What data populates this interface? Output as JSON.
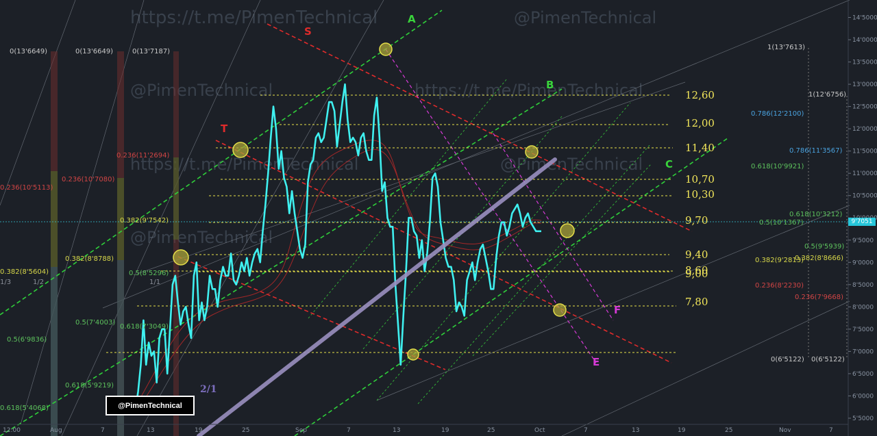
{
  "watermarks": {
    "w1": "https://t.me/PimenTechnical",
    "w2": "@PimenTechnical",
    "w3": "@PimenTechnical",
    "w4": "https://t.me/PimenTechnical",
    "w5": "https://t.me/PimenTechnical",
    "w6": "@PimenTechnical",
    "w7": "@PimenTechnical"
  },
  "brand_label": "@PimenTechnical",
  "current_price_tag": "9'7051",
  "colors": {
    "background": "#1c2027",
    "price_line": "#3ff0f0",
    "level_lines": "#e8e24a",
    "channel_green": "#39d33b",
    "resistance_red": "#e02b2b",
    "projection_magenta": "#d63ad6",
    "trendline": "#9a8fbf"
  },
  "chart_data": {
    "type": "line",
    "title": "",
    "xlabel": "",
    "ylabel": "",
    "ylim": [
      5100,
      14600
    ],
    "x_ticks": [
      "12:00",
      "Aug",
      "7",
      "13",
      "19",
      "25",
      "Sep",
      "7",
      "13",
      "19",
      "25",
      "Oct",
      "7",
      "13",
      "19",
      "25",
      "Nov",
      "7"
    ],
    "y_ticks": [
      "14'5000",
      "14'0000",
      "13'5000",
      "13'0000",
      "12'5000",
      "12'0000",
      "11'5000",
      "11'0000",
      "10'5000",
      "10'0000",
      "9'5000",
      "9'0000",
      "8'5000",
      "8'0000",
      "7'5000",
      "7'0000",
      "6'5000",
      "6'0000",
      "5'5000"
    ],
    "series": [
      {
        "values": [
          5600,
          5900,
          5700,
          6100,
          6700,
          7700,
          6700,
          7200,
          6900,
          7000,
          6300,
          7300,
          7500,
          7500,
          6500,
          7500,
          8500,
          8700,
          8100,
          7600,
          7900,
          8000,
          7600,
          7300,
          8700,
          9000,
          7700,
          8100,
          7700,
          8000,
          8700,
          8400,
          8400,
          8000,
          8600,
          8900,
          8700,
          8700,
          9200,
          8600,
          8500,
          8700,
          9000,
          8800,
          9100,
          8700,
          9000,
          9200,
          9300,
          9000,
          9700,
          10300,
          11000,
          11800,
          12500,
          12000,
          11100,
          11500,
          10900,
          10700,
          10100,
          10600,
          10100,
          9700,
          9300,
          9100,
          9400,
          10800,
          11200,
          11300,
          11800,
          11900,
          11700,
          11800,
          12200,
          12600,
          12600,
          12400,
          11600,
          12100,
          12600,
          13000,
          12200,
          11700,
          11800,
          11700,
          11400,
          11800,
          11900,
          11500,
          11300,
          11300,
          12300,
          12700,
          11800,
          10600,
          10800,
          10000,
          9800,
          9800,
          8500,
          7600,
          6700,
          7800,
          8800,
          10000,
          10000,
          9700,
          9600,
          9100,
          9500,
          8800,
          9200,
          9900,
          10900,
          11000,
          10700,
          9900,
          9500,
          9100,
          8900,
          8900,
          8600,
          7900,
          8100,
          8000,
          7800,
          8600,
          8800,
          9000,
          8600,
          9000,
          9300,
          9400,
          9100,
          8800,
          8400,
          8400,
          9100,
          9600,
          9900,
          9900,
          9600,
          9800,
          10100,
          10200,
          10300,
          10100,
          9800,
          10000,
          10100,
          9900,
          9800,
          9700,
          9700,
          9700
        ]
      }
    ],
    "annotations": {
      "horizontal_levels": [
        "12,60",
        "12,00",
        "11,40",
        "10,70",
        "10,30",
        "9,70",
        "9,40",
        "9,00",
        "8,60",
        "7,80"
      ],
      "channel_letters": [
        "A",
        "B",
        "C"
      ],
      "resistance_letters": [
        "S",
        "T"
      ],
      "projection_letters": [
        "E",
        "F"
      ],
      "ratio_label": "2/1",
      "fib_labels": [
        {
          "text": "0(13'6649)",
          "color": "#c9c9c9"
        },
        {
          "text": "0(13'6649)",
          "color": "#c9c9c9"
        },
        {
          "text": "0(13'7187)",
          "color": "#c9c9c9"
        },
        {
          "text": "0.236(10'5113)",
          "color": "#d24545"
        },
        {
          "text": "0.236(10'7080)",
          "color": "#d24545"
        },
        {
          "text": "0.236(11'2694)",
          "color": "#d24545"
        },
        {
          "text": "0.382(9'7542)",
          "color": "#d8d84a"
        },
        {
          "text": "0.382(8'8788)",
          "color": "#d8d84a"
        },
        {
          "text": "0.382(8'5604)",
          "color": "#d8d84a"
        },
        {
          "text": "0.5(8'5296)",
          "color": "#5dc25d"
        },
        {
          "text": "0.5(7'4003)",
          "color": "#5dc25d"
        },
        {
          "text": "0.5(6'9836)",
          "color": "#5dc25d"
        },
        {
          "text": "0.618(7'3049)",
          "color": "#5dc25d"
        },
        {
          "text": "0.618(5'9219)",
          "color": "#5dc25d"
        },
        {
          "text": "0.618(5'4068)",
          "color": "#5dc25d"
        },
        {
          "text": "1/1",
          "color": "#8a8f99"
        },
        {
          "text": "1/2",
          "color": "#8a8f99"
        },
        {
          "text": "1/3",
          "color": "#8a8f99"
        },
        {
          "text": "1(13'7613)",
          "color": "#c9c9c9"
        },
        {
          "text": "1(12'6756)",
          "color": "#c9c9c9"
        },
        {
          "text": "0.786(12'2100)",
          "color": "#4aa3e0"
        },
        {
          "text": "0.786(11'3567)",
          "color": "#4aa3e0"
        },
        {
          "text": "0.618(10'9921)",
          "color": "#5dc25d"
        },
        {
          "text": "0.618(10'3212)",
          "color": "#5dc25d"
        },
        {
          "text": "0.5(10'1367)",
          "color": "#5dc25d"
        },
        {
          "text": "0.5(9'5939)",
          "color": "#5dc25d"
        },
        {
          "text": "0.382(9'2813)",
          "color": "#d8d84a"
        },
        {
          "text": "0.382(8'8666)",
          "color": "#d8d84a"
        },
        {
          "text": "0.236(8'2230)",
          "color": "#d24545"
        },
        {
          "text": "0.236(7'9668)",
          "color": "#d24545"
        },
        {
          "text": "0(6'5122)",
          "color": "#c9c9c9"
        },
        {
          "text": "0(6'5122)",
          "color": "#c9c9c9"
        }
      ]
    }
  }
}
